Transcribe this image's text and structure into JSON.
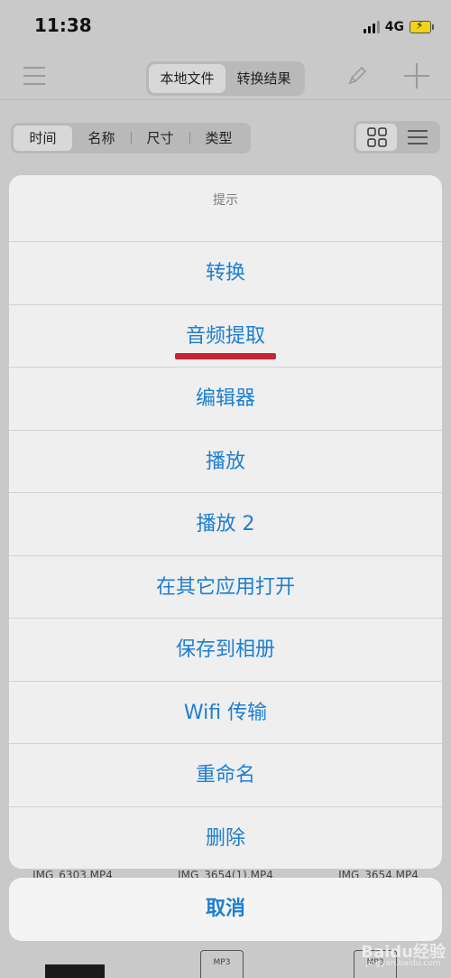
{
  "status_bar": {
    "time": "11:38",
    "network": "4G"
  },
  "nav_bar": {
    "tabs": [
      {
        "label": "本地文件",
        "active": true
      },
      {
        "label": "转换结果",
        "active": false
      }
    ]
  },
  "sort_bar": {
    "options": [
      {
        "label": "时间",
        "active": true
      },
      {
        "label": "名称",
        "active": false
      },
      {
        "label": "尺寸",
        "active": false
      },
      {
        "label": "类型",
        "active": false
      }
    ]
  },
  "background_files": {
    "names": [
      "IMG_6303.MP4",
      "IMG_3654(1).MP4",
      "IMG_3654.MP4"
    ],
    "file_icon_label": "MP3"
  },
  "action_sheet": {
    "title": "提示",
    "actions": [
      {
        "label": "转换"
      },
      {
        "label": "音频提取",
        "highlighted": true
      },
      {
        "label": "编辑器"
      },
      {
        "label": "播放"
      },
      {
        "label": "播放 2"
      },
      {
        "label": "在其它应用打开"
      },
      {
        "label": "保存到相册"
      },
      {
        "label": "Wifi 传输"
      },
      {
        "label": "重命名"
      },
      {
        "label": "删除"
      }
    ],
    "cancel_label": "取消",
    "action_color": "#1d7fd1",
    "highlight_color": "#c82233"
  },
  "watermark": {
    "text": "Baidu经验",
    "sub": "jingyan.baidu.com"
  }
}
